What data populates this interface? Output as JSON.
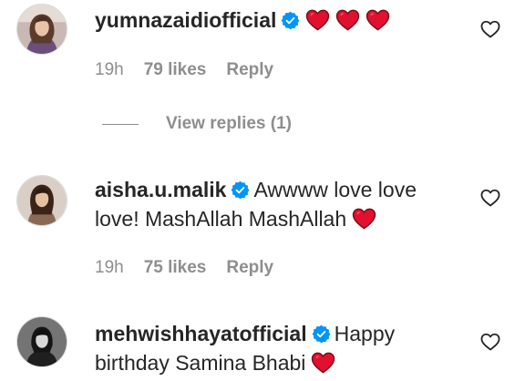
{
  "comments": [
    {
      "username": "yumnazaidiofficial",
      "text": "",
      "verified": true,
      "hearts": 3,
      "time": "19h",
      "likes": "79 likes",
      "reply_label": "Reply"
    },
    {
      "username": "aisha.u.malik",
      "text": "Awwww love love love! MashAllah MashAllah",
      "verified": true,
      "hearts": 1,
      "time": "19h",
      "likes": "75 likes",
      "reply_label": "Reply"
    },
    {
      "username": "mehwishhayatofficial",
      "text": "Happy birthday Samina Bhabi",
      "verified": true,
      "hearts": 1
    }
  ],
  "view_replies_label": "View replies (1)",
  "icons": {
    "verified": "verified-badge-icon",
    "heart_emoji": "red-heart-icon",
    "like": "heart-outline-icon"
  },
  "colors": {
    "text": "#262626",
    "muted": "#8e8e8e",
    "verified_blue": "#0095f6",
    "heart_red": "#e0102e"
  }
}
